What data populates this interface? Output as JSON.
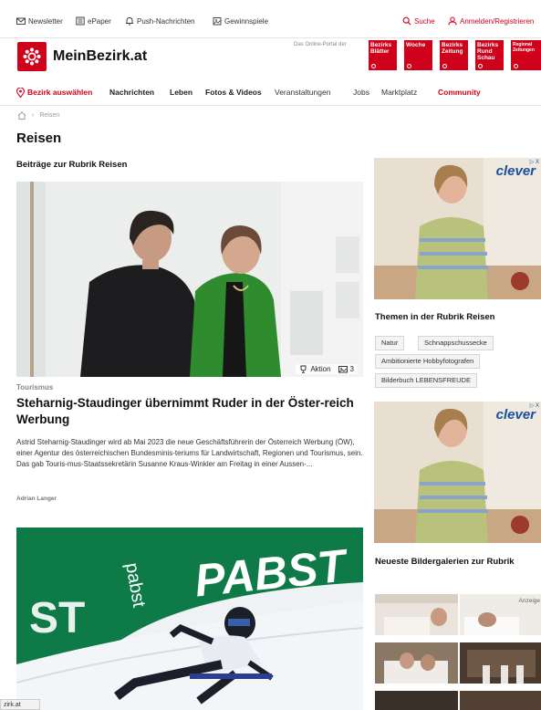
{
  "topbar": {
    "newsletter": "Newsletter",
    "epaper": "ePaper",
    "push": "Push-Nachrichten",
    "gewinnspiele": "Gewinnspiele",
    "suche": "Suche",
    "login": "Anmelden/Registrieren"
  },
  "brand": {
    "name": "MeinBezirk.at",
    "portal_label": "Das Online-Portal der",
    "tiles": [
      "Bezirks Blätter",
      "Woche",
      "Bezirks Zeitung",
      "Bezirks Rund Schau",
      "Regional Zeitungen"
    ],
    "accent": "#d0021b"
  },
  "nav": {
    "items": [
      "Bezirk auswählen",
      "Nachrichten",
      "Leben",
      "Fotos & Videos",
      "Veranstaltungen",
      "Jobs",
      "Marktplatz",
      "Community"
    ]
  },
  "breadcrumb": {
    "current": "Reisen"
  },
  "page": {
    "title": "Reisen",
    "section_title": "Beiträge zur Rubrik Reisen"
  },
  "article1": {
    "meta_label": "Aktion",
    "photo_count": "3",
    "tag": "Tourismus",
    "headline": "Steharnig-Staudinger übernimmt Ruder in der Öster-reich Werbung",
    "teaser": "Astrid Steharnig-Staudinger wird ab Mai 2023 die neue Geschäftsführerin der Österreich Werbung (ÖW), einer Agentur des österreichischen Bundesminis-teriums für Landwirtschaft, Regionen und Tourismus, sein. Das gab Touris-mus-Staatssekretärin Susanne Kraus-Winkler am Freitag in einer Aussen-...",
    "author": "Adrian Langer"
  },
  "article2": {
    "banner_text": "PABST",
    "banner_text_left": "ST",
    "banner_side": "pabst"
  },
  "sidebar": {
    "ad_brand": "clever",
    "ad_close": "▷ X",
    "themen_heading": "Themen in der Rubrik Reisen",
    "themen": [
      "Natur",
      "Schnappschussecke",
      "Ambitionierte Hobbyfotografen",
      "Bilderbuch LEBENSFREUDE"
    ],
    "galleries_heading": "Neueste Bildergalerien zur Rubrik",
    "anzeige": "Anzeige"
  },
  "statusbar": {
    "url_fragment": "zirk.at"
  }
}
